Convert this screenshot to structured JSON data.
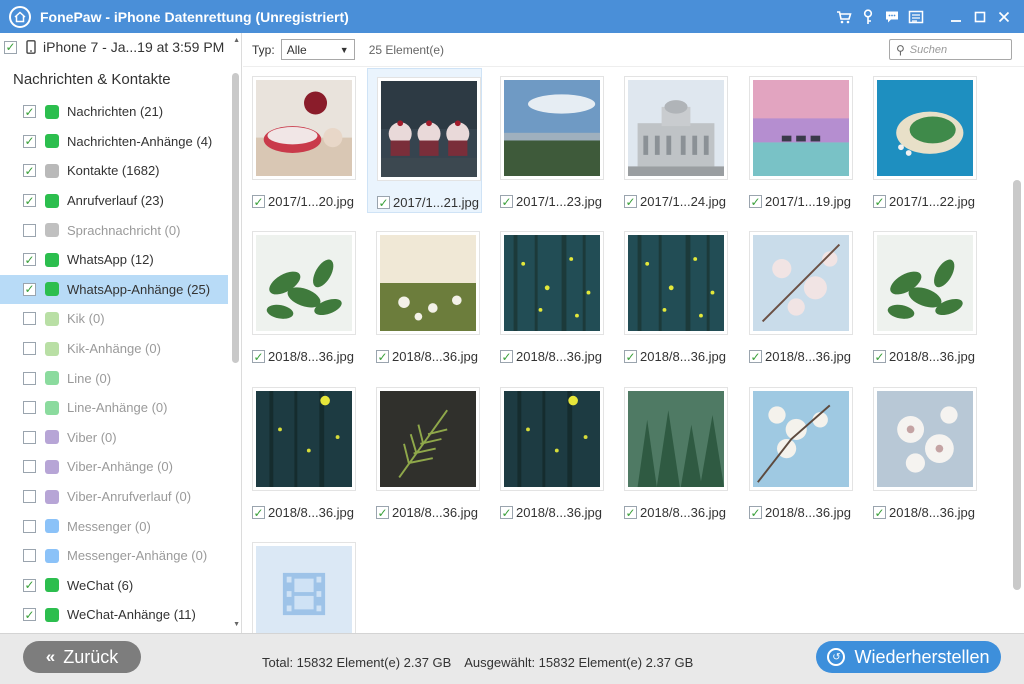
{
  "window": {
    "title": "FonePaw - iPhone Datenrettung (Unregistriert)"
  },
  "device": {
    "label": "iPhone 7 - Ja...19 at 3:59 PM"
  },
  "sidebar": {
    "section_title": "Nachrichten & Kontakte",
    "items": [
      {
        "label": "Nachrichten (21)",
        "checked": true,
        "enabled": true,
        "icon": "message-icon",
        "color": "#2cbe4e"
      },
      {
        "label": "Nachrichten-Anhänge (4)",
        "checked": true,
        "enabled": true,
        "icon": "message-icon",
        "color": "#2cbe4e"
      },
      {
        "label": "Kontakte (1682)",
        "checked": true,
        "enabled": true,
        "icon": "contacts-icon",
        "color": "#b9b9b9"
      },
      {
        "label": "Anrufverlauf (23)",
        "checked": true,
        "enabled": true,
        "icon": "phone-icon",
        "color": "#2cbe4e"
      },
      {
        "label": "Sprachnachricht (0)",
        "checked": false,
        "enabled": false,
        "icon": "voicemail-icon",
        "color": "#8c8c8c"
      },
      {
        "label": "WhatsApp (12)",
        "checked": true,
        "enabled": true,
        "icon": "whatsapp-icon",
        "color": "#2cbe4e"
      },
      {
        "label": "WhatsApp-Anhänge (25)",
        "checked": true,
        "enabled": true,
        "icon": "whatsapp-icon",
        "color": "#2cbe4e",
        "selected": true
      },
      {
        "label": "Kik (0)",
        "checked": false,
        "enabled": false,
        "icon": "kik-icon",
        "color": "#7fc55b"
      },
      {
        "label": "Kik-Anhänge (0)",
        "checked": false,
        "enabled": false,
        "icon": "kik-icon",
        "color": "#7fc55b"
      },
      {
        "label": "Line (0)",
        "checked": false,
        "enabled": false,
        "icon": "line-icon",
        "color": "#2cbe4e"
      },
      {
        "label": "Line-Anhänge (0)",
        "checked": false,
        "enabled": false,
        "icon": "line-icon",
        "color": "#2cbe4e"
      },
      {
        "label": "Viber (0)",
        "checked": false,
        "enabled": false,
        "icon": "viber-icon",
        "color": "#7b5bb5"
      },
      {
        "label": "Viber-Anhänge (0)",
        "checked": false,
        "enabled": false,
        "icon": "viber-icon",
        "color": "#7b5bb5"
      },
      {
        "label": "Viber-Anrufverlauf (0)",
        "checked": false,
        "enabled": false,
        "icon": "viber-icon",
        "color": "#7b5bb5"
      },
      {
        "label": "Messenger (0)",
        "checked": false,
        "enabled": false,
        "icon": "messenger-icon",
        "color": "#2b8ff2"
      },
      {
        "label": "Messenger-Anhänge (0)",
        "checked": false,
        "enabled": false,
        "icon": "messenger-icon",
        "color": "#2b8ff2"
      },
      {
        "label": "WeChat (6)",
        "checked": true,
        "enabled": true,
        "icon": "wechat-icon",
        "color": "#2cbe4e"
      },
      {
        "label": "WeChat-Anhänge (11)",
        "checked": true,
        "enabled": true,
        "icon": "wechat-icon",
        "color": "#2cbe4e"
      }
    ]
  },
  "toolbar": {
    "type_label": "Typ:",
    "type_value": "Alle",
    "count_text": "25 Element(e)",
    "search_placeholder": "Suchen"
  },
  "files": [
    {
      "name": "2017/1...20.jpg",
      "thumb": "cake-roll"
    },
    {
      "name": "2017/1...21.jpg",
      "thumb": "cupcakes",
      "selected": true
    },
    {
      "name": "2017/1...23.jpg",
      "thumb": "city-sky"
    },
    {
      "name": "2017/1...24.jpg",
      "thumb": "building"
    },
    {
      "name": "2017/1...19.jpg",
      "thumb": "sunset-huts"
    },
    {
      "name": "2017/1...22.jpg",
      "thumb": "island"
    },
    {
      "name": "2018/8...36.jpg",
      "thumb": "green-leaves"
    },
    {
      "name": "2018/8...36.jpg",
      "thumb": "dandelion"
    },
    {
      "name": "2018/8...36.jpg",
      "thumb": "fireflies"
    },
    {
      "name": "2018/8...36.jpg",
      "thumb": "fireflies"
    },
    {
      "name": "2018/8...36.jpg",
      "thumb": "blossom"
    },
    {
      "name": "2018/8...36.jpg",
      "thumb": "green-leaves"
    },
    {
      "name": "2018/8...36.jpg",
      "thumb": "fireflies-dark"
    },
    {
      "name": "2018/8...36.jpg",
      "thumb": "fern"
    },
    {
      "name": "2018/8...36.jpg",
      "thumb": "fireflies-dark"
    },
    {
      "name": "2018/8...36.jpg",
      "thumb": "forest"
    },
    {
      "name": "2018/8...36.jpg",
      "thumb": "blossom-sky"
    },
    {
      "name": "2018/8...36.jpg",
      "thumb": "white-flowers"
    },
    {
      "name": "",
      "thumb": "video-placeholder"
    }
  ],
  "footer": {
    "back_label": "Zurück",
    "total_text": "Total: 15832 Element(e) 2.37 GB",
    "selected_text": "Ausgewählt: 15832 Element(e) 2.37 GB",
    "restore_label": "Wiederherstellen"
  },
  "colors": {
    "titlebar": "#4a8fd8",
    "accent": "#3d8fdb",
    "selection": "#b8dbf7"
  }
}
